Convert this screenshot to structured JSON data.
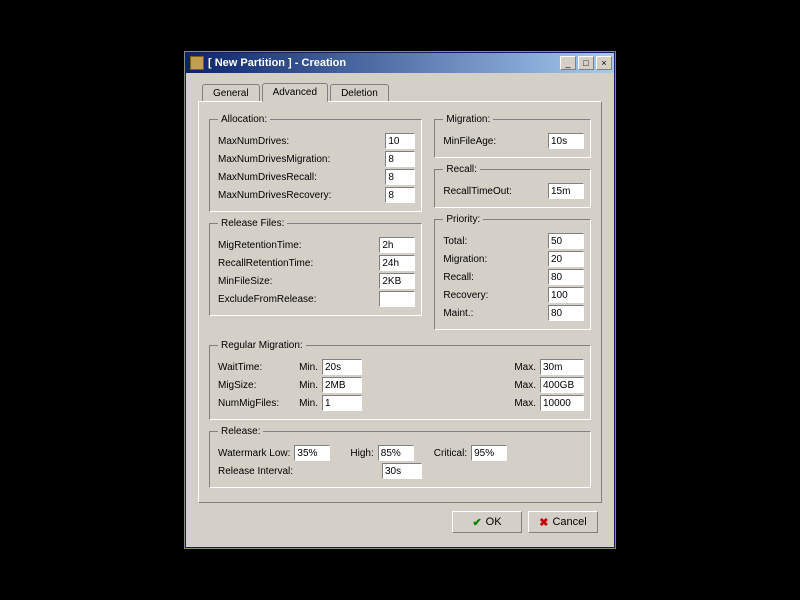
{
  "window": {
    "title": "[ New Partition ] - Creation"
  },
  "tabs": {
    "general": "General",
    "advanced": "Advanced",
    "deletion": "Deletion",
    "active": "advanced"
  },
  "allocation": {
    "legend": "Allocation:",
    "maxNumDrives_label": "MaxNumDrives:",
    "maxNumDrives_value": "10",
    "maxNumDrivesMigration_label": "MaxNumDrivesMigration:",
    "maxNumDrivesMigration_value": "8",
    "maxNumDrivesRecall_label": "MaxNumDrivesRecall:",
    "maxNumDrivesRecall_value": "8",
    "maxNumDrivesRecovery_label": "MaxNumDrivesRecovery:",
    "maxNumDrivesRecovery_value": "8"
  },
  "migration": {
    "legend": "Migration:",
    "minFileAge_label": "MinFileAge:",
    "minFileAge_value": "10s"
  },
  "recall": {
    "legend": "Recall:",
    "recallTimeOut_label": "RecallTimeOut:",
    "recallTimeOut_value": "15m"
  },
  "priority": {
    "legend": "Priority:",
    "total_label": "Total:",
    "total_value": "50",
    "migration_label": "Migration:",
    "migration_value": "20",
    "recall_label": "Recall:",
    "recall_value": "80",
    "recovery_label": "Recovery:",
    "recovery_value": "100",
    "maint_label": "Maint.:",
    "maint_value": "80"
  },
  "releaseFiles": {
    "legend": "Release Files:",
    "migRetentionTime_label": "MigRetentionTime:",
    "migRetentionTime_value": "2h",
    "recallRetentionTime_label": "RecallRetentionTime:",
    "recallRetentionTime_value": "24h",
    "minFileSize_label": "MinFileSize:",
    "minFileSize_value": "2KB",
    "excludeFromRelease_label": "ExcludeFromRelease:",
    "excludeFromRelease_value": ""
  },
  "regularMigration": {
    "legend": "Regular Migration:",
    "min_label": "Min.",
    "max_label": "Max.",
    "waitTime_label": "WaitTime:",
    "waitTime_min": "20s",
    "waitTime_max": "30m",
    "migSize_label": "MigSize:",
    "migSize_min": "2MB",
    "migSize_max": "400GB",
    "numMigFiles_label": "NumMigFiles:",
    "numMigFiles_min": "1",
    "numMigFiles_max": "10000"
  },
  "release": {
    "legend": "Release:",
    "watermark_label": "Watermark Low:",
    "watermark_low": "35%",
    "high_label": "High:",
    "watermark_high": "85%",
    "critical_label": "Critical:",
    "watermark_critical": "95%",
    "releaseInterval_label": "Release Interval:",
    "releaseInterval_value": "30s"
  },
  "buttons": {
    "ok": "OK",
    "cancel": "Cancel"
  }
}
